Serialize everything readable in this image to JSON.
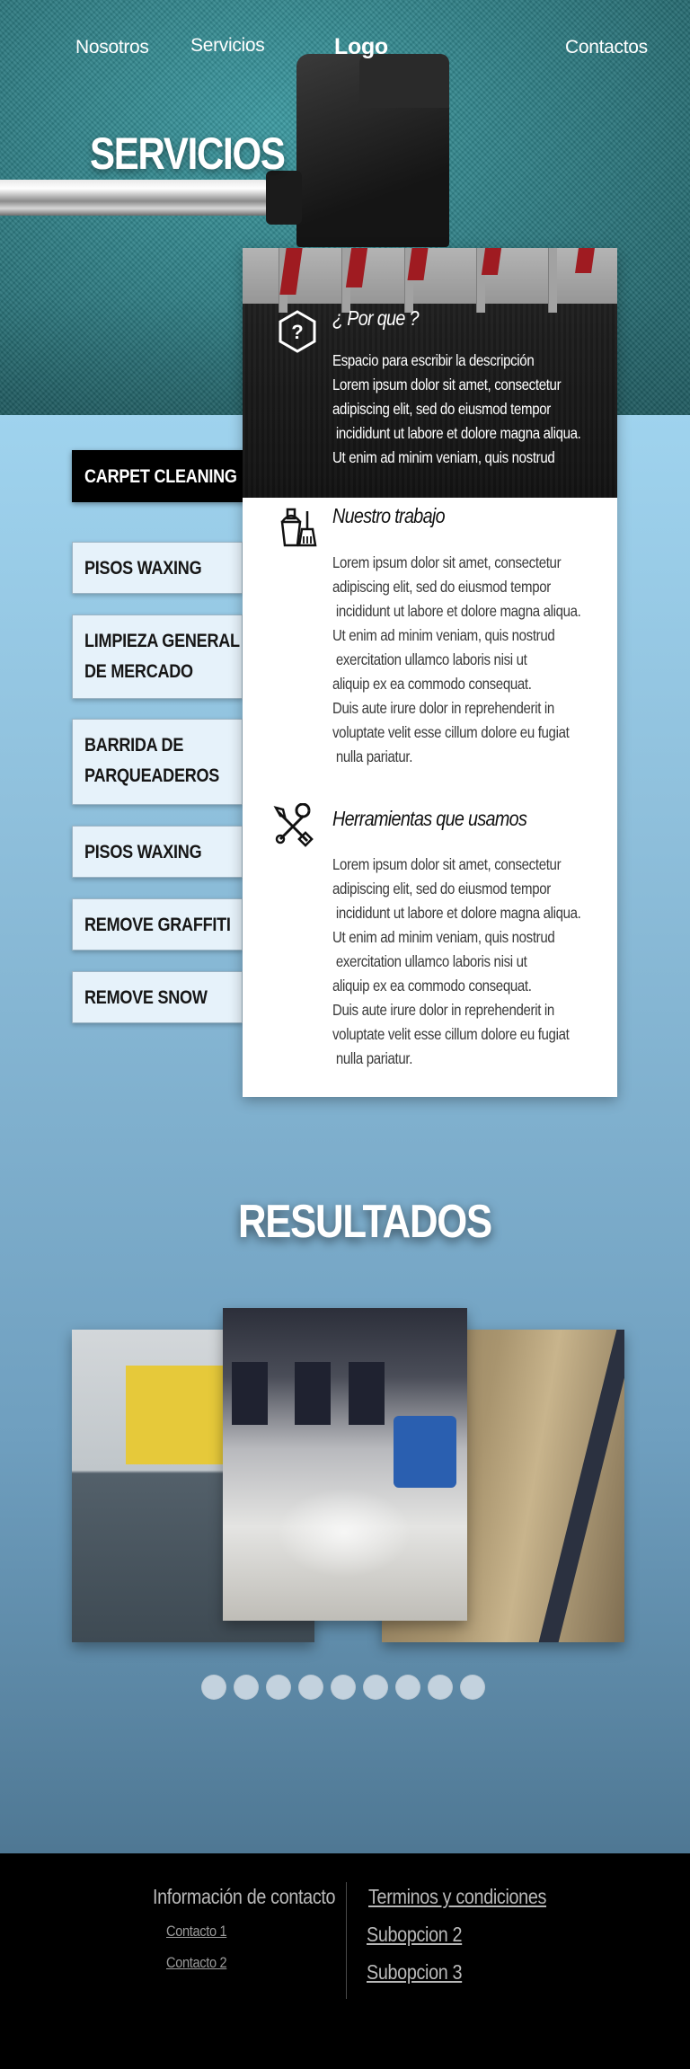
{
  "nav": {
    "items": [
      "Nosotros",
      "Servicios",
      "Logo",
      "Contactos"
    ]
  },
  "hero": {
    "title": "SERVICIOS"
  },
  "menu": {
    "items": [
      {
        "label": "CARPET CLEANING",
        "active": true
      },
      {
        "label": "PISOS WAXING"
      },
      {
        "label_line1": "LIMPIEZA GENERAL",
        "label_line2": "DE MERCADO"
      },
      {
        "label_line1": "BARRIDA DE",
        "label_line2": "PARQUEADEROS"
      },
      {
        "label": "PISOS WAXING"
      },
      {
        "label": "REMOVE GRAFFITI"
      },
      {
        "label": "REMOVE SNOW"
      }
    ]
  },
  "card": {
    "sections": [
      {
        "icon": "question-hexagon-icon",
        "title": "¿ Por que ?",
        "text": "Espacio para escribir la descripción\nLorem ipsum dolor sit amet, consectetur\nadipiscing elit, sed do eiusmod tempor\n incididunt ut labore et dolore magna aliqua.\nUt enim ad minim veniam, quis nostrud"
      },
      {
        "icon": "cleaning-bucket-icon",
        "title": "Nuestro trabajo",
        "text": "Lorem ipsum dolor sit amet, consectetur\nadipiscing elit, sed do eiusmod tempor\n incididunt ut labore et dolore magna aliqua.\nUt enim ad minim veniam, quis nostrud\n exercitation ullamco laboris nisi ut\naliquip ex ea commodo consequat.\nDuis aute irure dolor in reprehenderit in\nvoluptate velit esse cillum dolore eu fugiat\n nulla pariatur."
      },
      {
        "icon": "tools-icon",
        "title": "Herramientas que usamos",
        "text": "Lorem ipsum dolor sit amet, consectetur\nadipiscing elit, sed do eiusmod tempor\n incididunt ut labore et dolore magna aliqua.\nUt enim ad minim veniam, quis nostrud\n exercitation ullamco laboris nisi ut\naliquip ex ea commodo consequat.\nDuis aute irure dolor in reprehenderit in\nvoluptate velit esse cillum dolore eu fugiat\n nulla pariatur."
      }
    ]
  },
  "results": {
    "title": "RESULTADOS",
    "dot_count": 9,
    "dot_color": "#c3d2de"
  },
  "footer": {
    "contact_title": "Información de contacto",
    "contacts": [
      "Contacto 1",
      "Contacto 2"
    ],
    "options": [
      "Terminos y condiciones",
      "Subopcion 2",
      "Subopcion 3"
    ]
  },
  "colors": {
    "active_menu_bg": "#000000",
    "menu_bg": "#e6f2fa",
    "footer_bg": "#000000"
  }
}
